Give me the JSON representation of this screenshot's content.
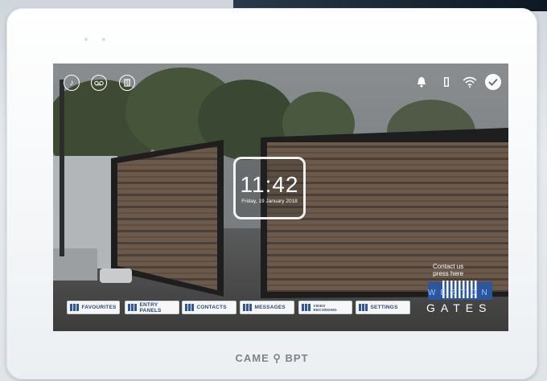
{
  "clock": {
    "time": "11:42",
    "date": "Friday, 19 January 2018"
  },
  "nav": {
    "favourites": "FAVOURITES",
    "entry_panels": "ENTRY PANELS",
    "contacts": "CONTACTS",
    "messages": "MESSAGES",
    "video_recording_line1": "VIDEO",
    "video_recording_line2": "RECORDING",
    "settings": "SETTINGS"
  },
  "contact_prompt": {
    "line1": "Contact us",
    "line2": "press here"
  },
  "logo": {
    "line1": "WESTON",
    "line2": "GATES"
  },
  "brand": "CAME ⚲ BPT",
  "icons": {
    "top_left": [
      "do-not-disturb-icon",
      "voicemail-icon",
      "door-icon"
    ],
    "top_right": [
      "bell-icon",
      "door-status-icon",
      "wifi-icon",
      "check-circle-icon"
    ]
  },
  "colors": {
    "button_accent": "#2c56a0",
    "button_text": "#2d4a6e"
  }
}
